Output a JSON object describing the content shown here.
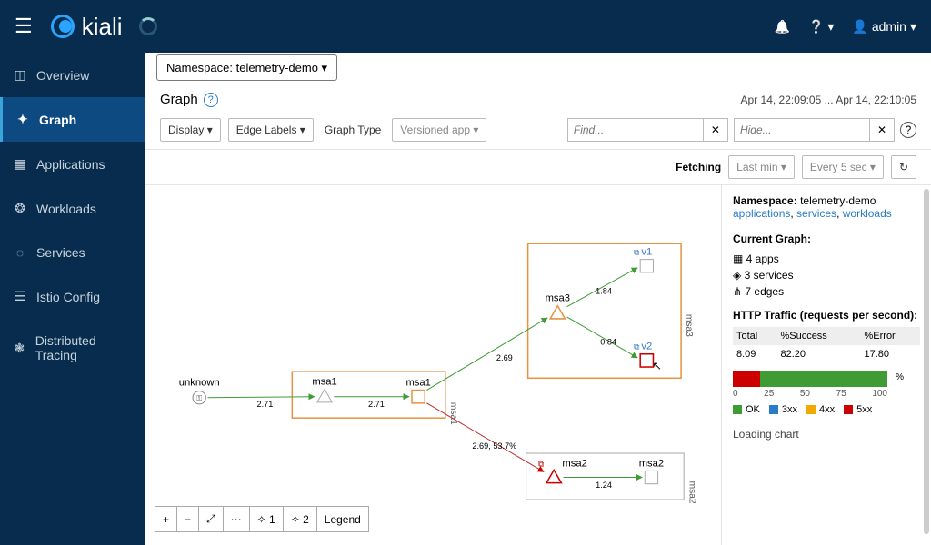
{
  "brand": "kiali",
  "user": "admin",
  "sidebar": {
    "items": [
      {
        "label": "Overview",
        "icon": "◫"
      },
      {
        "label": "Graph",
        "icon": "✦",
        "active": true
      },
      {
        "label": "Applications",
        "icon": "▦"
      },
      {
        "label": "Workloads",
        "icon": "❂"
      },
      {
        "label": "Services",
        "icon": "◌"
      },
      {
        "label": "Istio Config",
        "icon": "☰"
      },
      {
        "label": "Distributed Tracing",
        "icon": "❃"
      }
    ]
  },
  "namespace": {
    "label": "Namespace:",
    "value": "telemetry-demo"
  },
  "page_title": "Graph",
  "time_range": "Apr 14, 22:09:05 ... Apr 14, 22:10:05",
  "toolbar": {
    "display": "Display",
    "edge_labels": "Edge Labels",
    "graph_type": "Graph Type",
    "graph_type_value": "Versioned app",
    "find_placeholder": "Find...",
    "hide_placeholder": "Hide...",
    "fetching": "Fetching",
    "last": "Last min",
    "every": "Every 5 sec",
    "refresh": "↻"
  },
  "graph": {
    "nodes": {
      "unknown": "unknown",
      "msa1_svc": "msa1",
      "msa1_wl": "msa1",
      "msa1_grp": "msa1",
      "msa2_wl": "msa2",
      "msa2_svc": "msa2",
      "msa2_grp": "msa2",
      "msa3_svc": "msa3",
      "msa3_grp": "msa3",
      "v1": "v1",
      "v2": "v2"
    },
    "edges": {
      "e1": "2.71",
      "e2": "2.71",
      "e3": "2.69",
      "e4": "1.84",
      "e5": "0.84",
      "e6": "2.69, 53.7%",
      "e7": "1.24"
    }
  },
  "zoom": {
    "plus": "+",
    "minus": "−",
    "sep": "|",
    "fit": "⤢",
    "layout": "⋯",
    "l1": "✧ 1",
    "l2": "✧ 2",
    "legend": "Legend"
  },
  "panel": {
    "ns_label": "Namespace:",
    "ns_value": "telemetry-demo",
    "links": {
      "applications": "applications",
      "services": "services",
      "workloads": "workloads"
    },
    "current_graph": "Current Graph:",
    "stats": {
      "apps": "4 apps",
      "services": "3 services",
      "edges": "7 edges"
    },
    "http_title": "HTTP Traffic (requests per second):",
    "cols": {
      "total": "Total",
      "success": "%Success",
      "error": "%Error"
    },
    "vals": {
      "total": "8.09",
      "success": "82.20",
      "error": "17.80"
    },
    "axis": [
      "0",
      "25",
      "50",
      "75",
      "100"
    ],
    "legend": {
      "ok": "OK",
      "3xx": "3xx",
      "4xx": "4xx",
      "5xx": "5xx"
    },
    "loading": "Loading chart"
  },
  "chart_data": {
    "type": "bar",
    "title": "HTTP Traffic (requests per second)",
    "categories": [
      "Total",
      "%Success",
      "%Error"
    ],
    "values": [
      8.09,
      82.2,
      17.8
    ],
    "stacked_bar": {
      "segments": [
        {
          "name": "5xx",
          "value": 17.8,
          "color": "#c00"
        },
        {
          "name": "OK",
          "value": 82.2,
          "color": "#3f9c35"
        }
      ],
      "xlim": [
        0,
        100
      ]
    },
    "legend_colors": {
      "OK": "#3f9c35",
      "3xx": "#2a7cc7",
      "4xx": "#f0ab00",
      "5xx": "#c00"
    }
  }
}
